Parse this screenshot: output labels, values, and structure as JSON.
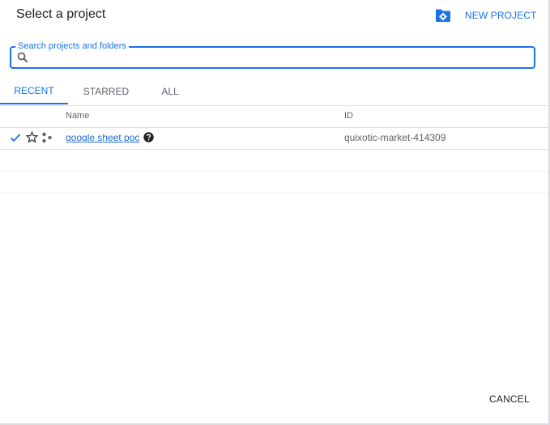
{
  "dialog": {
    "title": "Select a project",
    "new_project_label": "NEW PROJECT",
    "new_project_icon": "folder-gear-icon",
    "cancel_label": "CANCEL"
  },
  "search": {
    "legend": "Search projects and folders",
    "value": "",
    "placeholder": "",
    "icon": "search-icon"
  },
  "tabs": [
    {
      "label": "RECENT",
      "active": true
    },
    {
      "label": "STARRED",
      "active": false
    },
    {
      "label": "ALL",
      "active": false
    }
  ],
  "table": {
    "columns": [
      "Name",
      "ID"
    ],
    "rows": [
      {
        "selected": true,
        "starred": false,
        "type_icon": "organization-icon",
        "name": "google sheet poc",
        "help_icon": "help-icon",
        "id": "quixotic-market-414309"
      }
    ]
  },
  "colors": {
    "accent": "#1a73e8",
    "text": "#202124",
    "muted": "#5f6368",
    "divider": "#e0e0e0"
  }
}
